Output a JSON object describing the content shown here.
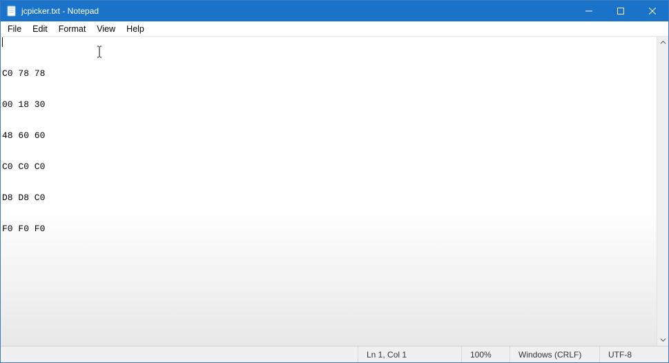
{
  "window": {
    "title": "jcpicker.txt - Notepad"
  },
  "menu": {
    "file": "File",
    "edit": "Edit",
    "format": "Format",
    "view": "View",
    "help": "Help"
  },
  "document": {
    "lines": [
      "C0 78 78",
      "00 18 30",
      "48 60 60",
      "C0 C0 C0",
      "D8 D8 C0",
      "F0 F0 F0"
    ]
  },
  "status": {
    "position": "Ln 1, Col 1",
    "zoom": "100%",
    "line_ending": "Windows (CRLF)",
    "encoding": "UTF-8"
  }
}
